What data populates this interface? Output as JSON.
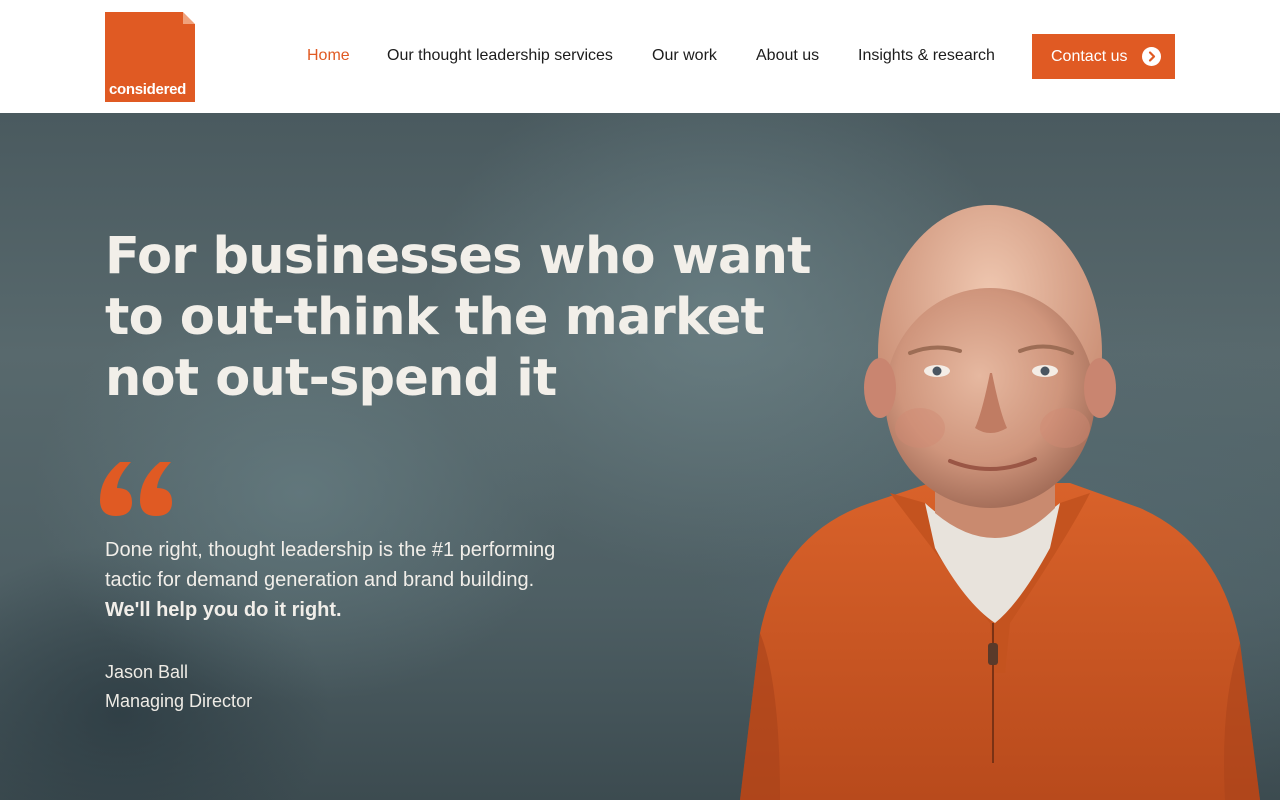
{
  "brand": {
    "logo_text": "considered",
    "accent_color": "#e05a23"
  },
  "nav": {
    "items": [
      {
        "label": "Home",
        "active": true
      },
      {
        "label": "Our thought leadership services",
        "active": false
      },
      {
        "label": "Our work",
        "active": false
      },
      {
        "label": "About us",
        "active": false
      },
      {
        "label": "Insights & research",
        "active": false
      }
    ],
    "contact_label": "Contact us",
    "contact_icon": "arrow-right-circle-icon"
  },
  "hero": {
    "heading_lines": [
      "For businesses who want",
      "to out-think the market",
      "not out-spend it"
    ],
    "quote_icon": "quote-mark-icon",
    "quote_lines": [
      "Done right, thought leadership is the #1 performing",
      "tactic for demand generation and brand building."
    ],
    "quote_strong": "We'll help you do it right.",
    "author_name": "Jason Ball",
    "author_title": "Managing Director"
  }
}
